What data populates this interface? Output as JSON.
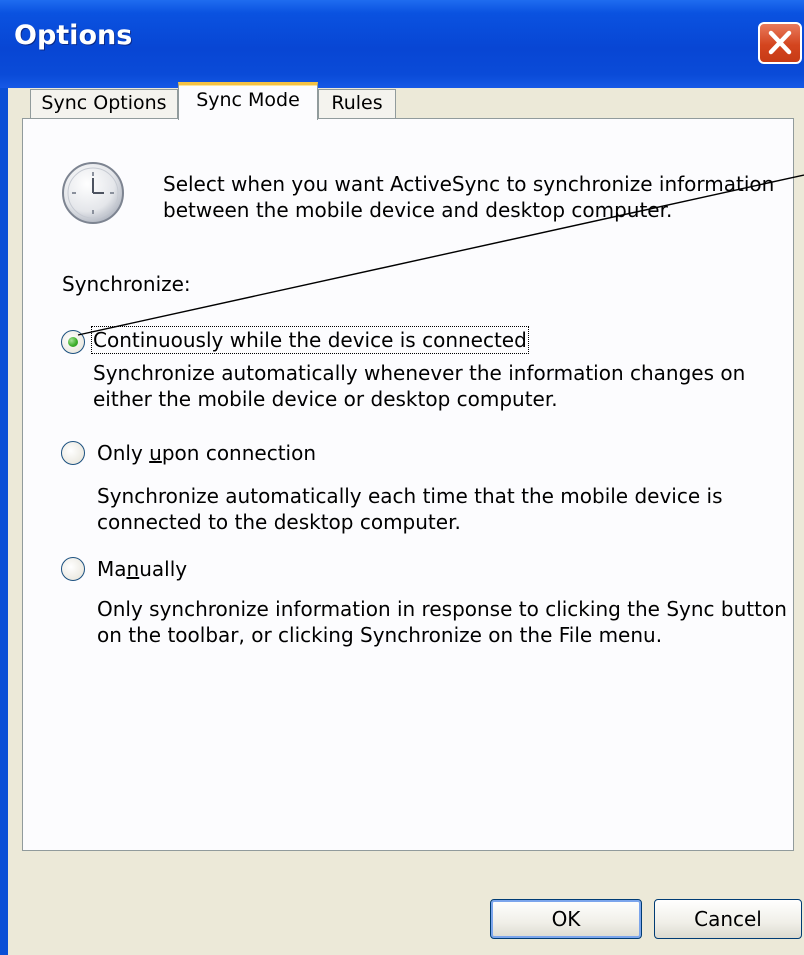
{
  "window": {
    "title": "Options"
  },
  "tabs": [
    {
      "label": "Sync Options",
      "active": false
    },
    {
      "label": "Sync Mode",
      "active": true
    },
    {
      "label": "Rules",
      "active": false
    }
  ],
  "panel": {
    "intro_line1": "Select when you want ActiveSync to synchronize information",
    "intro_line2": "between the mobile device and desktop computer.",
    "group_label": "Synchronize:",
    "options": [
      {
        "label": "Continuously while the device is connected",
        "desc_line1": "Synchronize automatically whenever the information changes on",
        "desc_line2": "either the mobile device or desktop computer.",
        "checked": true
      },
      {
        "label_before": "Only ",
        "label_mnemonic": "u",
        "label_after": "pon connection",
        "desc_line1": "Synchronize automatically each time that the mobile device is",
        "desc_line2": "connected to the desktop computer.",
        "checked": false
      },
      {
        "label_before": "Ma",
        "label_mnemonic": "n",
        "label_after": "ually",
        "desc_line1": "Only synchronize information in response to clicking the Sync button",
        "desc_line2": "on the toolbar, or clicking Synchronize on the File menu.",
        "checked": false
      }
    ]
  },
  "buttons": {
    "ok": "OK",
    "cancel": "Cancel"
  },
  "icons": {
    "clock": "clock-icon",
    "close": "close-icon"
  },
  "colors": {
    "titlebar": "#0846d4",
    "dialog_bg": "#ece9d8",
    "tab_highlight": "#f5c243",
    "close_button": "#d4451f"
  }
}
